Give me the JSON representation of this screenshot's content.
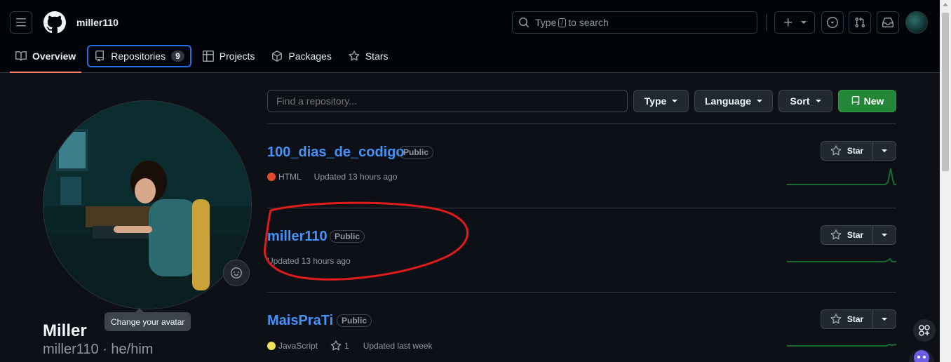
{
  "header": {
    "username": "miller110",
    "search": {
      "prefix": "Type",
      "key": "/",
      "suffix": "to search"
    }
  },
  "tabs": [
    {
      "label": "Overview",
      "icon": "book-icon"
    },
    {
      "label": "Repositories",
      "icon": "repo-icon",
      "count": "9"
    },
    {
      "label": "Projects",
      "icon": "table-icon"
    },
    {
      "label": "Packages",
      "icon": "package-icon"
    },
    {
      "label": "Stars",
      "icon": "star-icon"
    }
  ],
  "profile": {
    "name": "Miller",
    "login": "miller110 · he/him",
    "avatar_tooltip": "Change your avatar"
  },
  "filters": {
    "find_placeholder": "Find a repository...",
    "type": "Type",
    "language": "Language",
    "sort": "Sort",
    "new": "New"
  },
  "repos": [
    {
      "name": "100_dias_de_codigo",
      "visibility": "Public",
      "language": "HTML",
      "language_color": "#e34c26",
      "updated": "Updated 13 hours ago",
      "star_label": "Star"
    },
    {
      "name": "miller110",
      "visibility": "Public",
      "updated": "Updated 13 hours ago",
      "star_label": "Star"
    },
    {
      "name": "MaisPraTi",
      "visibility": "Public",
      "language": "JavaScript",
      "language_color": "#f1e05a",
      "stars": "1",
      "updated": "Updated last week",
      "star_label": "Star"
    }
  ],
  "colors": {
    "accent": "#4493f8",
    "new_button": "#238636",
    "annotation": "#e01b1b",
    "tab_underline": "#f78166"
  }
}
